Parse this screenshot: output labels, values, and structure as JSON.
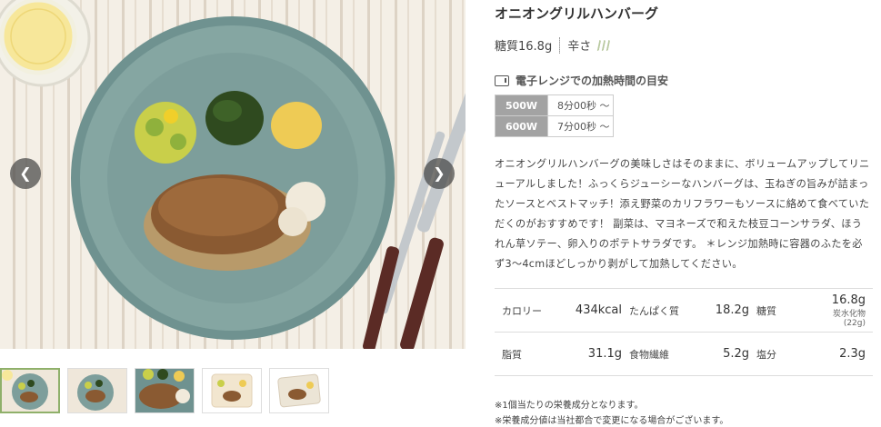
{
  "product": {
    "title": "オニオングリルハンバーグ",
    "sugar_label": "糖質16.8g",
    "spice_label": "辛さ",
    "spice_level": 0
  },
  "gallery": {
    "prev_icon": "chevron-left-icon",
    "next_icon": "chevron-right-icon",
    "thumbnail_count": 5,
    "active_thumbnail": 1
  },
  "heating": {
    "title": "電子レンジでの加熱時間の目安",
    "rows": [
      {
        "watt": "500W",
        "time": "8分00秒 〜"
      },
      {
        "watt": "600W",
        "time": "7分00秒 〜"
      }
    ]
  },
  "description": "オニオングリルハンバーグの美味しさはそのままに、ボリュームアップしてリニューアルしました！ふっくらジューシーなハンバーグは、玉ねぎの旨みが詰まったソースとベストマッチ！添え野菜のカリフラワーもソースに絡めて食べていただくのがおすすめです！ 副菜は、マヨネーズで和えた枝豆コーンサラダ、ほうれん草ソテー、卵入りのポテトサラダです。 ＊レンジ加熱時に容器のふたを必ず3〜4cmほどしっかり剥がして加熱してください。",
  "nutrition": {
    "row1": {
      "calorie_label": "カロリー",
      "calorie_value": "434kcal",
      "protein_label": "たんぱく質",
      "protein_value": "18.2g",
      "sugar_label": "糖質",
      "sugar_value": "16.8g",
      "carb_note": "炭水化物(22g)"
    },
    "row2": {
      "fat_label": "脂質",
      "fat_value": "31.1g",
      "fiber_label": "食物繊維",
      "fiber_value": "5.2g",
      "salt_label": "塩分",
      "salt_value": "2.3g"
    }
  },
  "notes": [
    "※1個当たりの栄養成分となります。",
    "※栄養成分値は当社都合で変更になる場合がございます。"
  ],
  "colors": {
    "plate": "#7f9e9a",
    "watt_bg": "#a3a3a3",
    "active_thumb_border": "#8fb06a"
  }
}
